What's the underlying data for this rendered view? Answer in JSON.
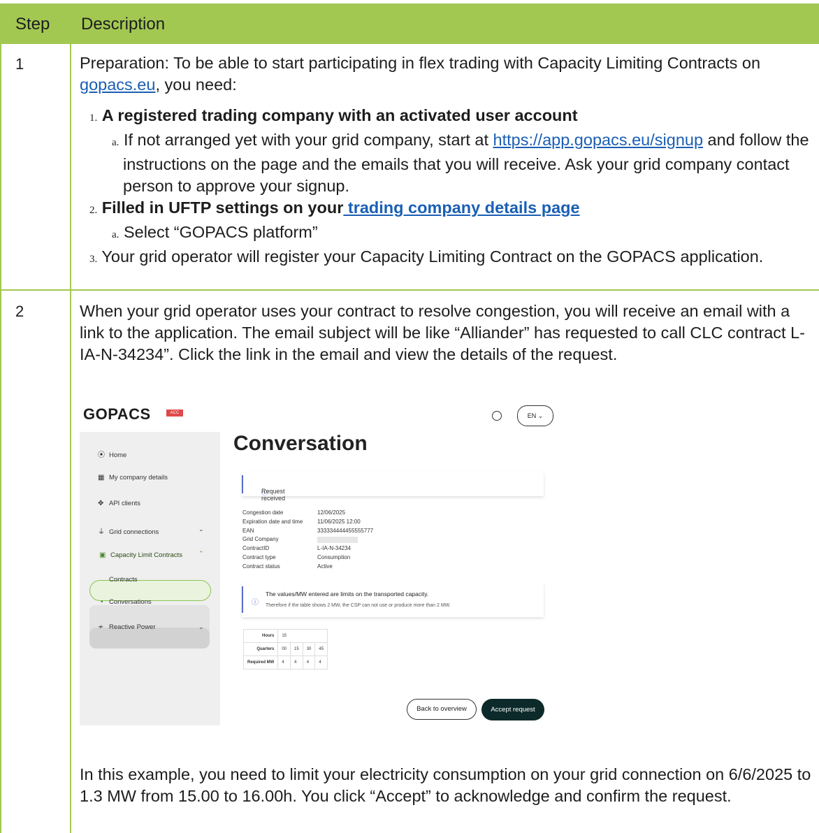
{
  "table": {
    "header": {
      "step": "Step",
      "description": "Description"
    },
    "row1": {
      "step": "1",
      "intro_before": "Preparation: To be able to start participating in flex trading with Capacity Limiting Contracts on ",
      "intro_link": "gopacs.eu",
      "intro_after": ", you need:",
      "item1_num": "1.",
      "item1_bold": "A registered trading company with an activated user account",
      "item1a_num": "a.",
      "item1a_before": "If not arranged yet with your grid company, start at ",
      "item1a_link": "https://app.gopacs.eu/signup",
      "item1a_after": " and follow the instructions on the page and the emails that you will receive. Ask your grid company contact person to approve your signup.",
      "item2_num": "2.",
      "item2_bold": "Filled in UFTP settings on your",
      "item2_link": " trading company details page",
      "item2a_num": "a.",
      "item2a_text": "Select “GOPACS platform”",
      "item3_num": "3.",
      "item3_text": "Your grid operator will register your Capacity Limiting Contract on the GOPACS application."
    },
    "row2": {
      "step": "2",
      "text": "When your grid operator uses your contract to resolve congestion, you will receive an email with a link to the application. The email subject will be like “Alliander” has requested to call CLC contract L-IA-N-34234”. Click the link in the email and view the details of the request.",
      "footer": "In this example, you need to limit your electricity consumption on your grid connection on 6/6/2025 to 1.3 MW from 15.00 to 16.00h. You click “Accept” to acknowledge and confirm the request."
    }
  },
  "screenshot": {
    "logo": "GOPACS",
    "env_badge": "ACC",
    "lang": "EN ⌄",
    "sidebar": {
      "home": "Home",
      "company": "My company details",
      "api": "API clients",
      "grid": "Grid connections",
      "clc": "Capacity Limit Contracts",
      "contracts": "Contracts",
      "conversations": "Conversations",
      "reactive": "Reactive Power"
    },
    "title": "Conversation",
    "status": "Request received",
    "details": [
      {
        "k": "Congestion date",
        "v": "12/06/2025"
      },
      {
        "k": "Expiration date and time",
        "v": "11/06/2025 12:00"
      },
      {
        "k": "EAN",
        "v": "333334444455555777"
      },
      {
        "k": "Grid Company",
        "v": ""
      },
      {
        "k": "ContractID",
        "v": "L-IA-N-34234"
      },
      {
        "k": "Contract type",
        "v": "Consumption"
      },
      {
        "k": "Contract status",
        "v": "Active"
      }
    ],
    "info_title": "The values/MW entered are limits on the transported capacity.",
    "info_text": "Therefore if the table shows 2 MW, the CSP can not use or produce more than 2 MW.",
    "mini_table": {
      "hours_label": "Hours",
      "hours_value": "15",
      "quarters_label": "Quarters",
      "quarters": [
        "00",
        "15",
        "30",
        "45"
      ],
      "required_label": "Required MW",
      "required": [
        "4",
        "4",
        "4",
        "4"
      ]
    },
    "back_button": "Back to overview",
    "accept_button": "Accept request"
  },
  "colors": {
    "header_bg": "#a2c852",
    "link": "#1a5fb4",
    "accept_bg": "#0d2a2a"
  }
}
